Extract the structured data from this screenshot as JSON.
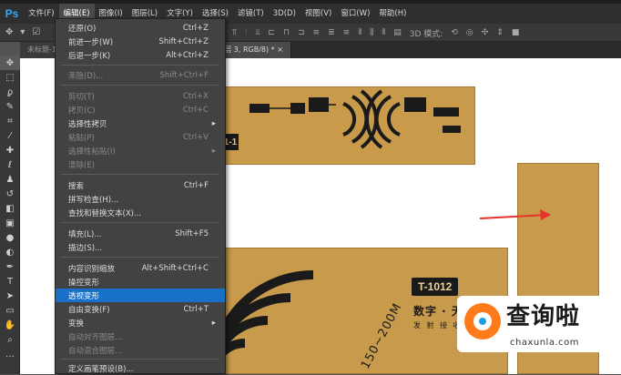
{
  "app": {
    "logo": "Ps"
  },
  "menubar": {
    "items": [
      "文件(F)",
      "编辑(E)",
      "图像(I)",
      "图层(L)",
      "文字(Y)",
      "选择(S)",
      "滤镜(T)",
      "3D(D)",
      "视图(V)",
      "窗口(W)",
      "帮助(H)"
    ],
    "active_index": 1
  },
  "optionsbar": {
    "mode_label": "3D 模式:"
  },
  "tabs": [
    {
      "label": "未标题-1",
      "close": "×"
    },
    {
      "label": "图层 3, RGB/8) *",
      "close": "×"
    }
  ],
  "edit_menu": {
    "items": [
      {
        "label": "还原(O)",
        "shortcut": "Ctrl+Z",
        "disabled": false
      },
      {
        "label": "前进一步(W)",
        "shortcut": "Shift+Ctrl+Z",
        "disabled": false
      },
      {
        "label": "后退一步(K)",
        "shortcut": "Alt+Ctrl+Z",
        "disabled": false
      },
      {
        "label": "渐隐(D)...",
        "shortcut": "Shift+Ctrl+F",
        "disabled": true
      },
      {
        "label": "剪切(T)",
        "shortcut": "Ctrl+X",
        "disabled": true
      },
      {
        "label": "拷贝(C)",
        "shortcut": "Ctrl+C",
        "disabled": true
      },
      {
        "label": "选择性拷贝",
        "shortcut": "",
        "disabled": false,
        "submenu": true
      },
      {
        "label": "粘贴(P)",
        "shortcut": "Ctrl+V",
        "disabled": true
      },
      {
        "label": "选择性粘贴(I)",
        "shortcut": "",
        "disabled": true,
        "submenu": true
      },
      {
        "label": "清除(E)",
        "shortcut": "",
        "disabled": true
      },
      {
        "label": "搜索",
        "shortcut": "Ctrl+F",
        "disabled": false
      },
      {
        "label": "拼写检查(H)...",
        "shortcut": "",
        "disabled": false
      },
      {
        "label": "查找和替换文本(X)...",
        "shortcut": "",
        "disabled": false
      },
      {
        "label": "填充(L)...",
        "shortcut": "Shift+F5",
        "disabled": false
      },
      {
        "label": "描边(S)...",
        "shortcut": "",
        "disabled": false
      },
      {
        "label": "内容识别缩放",
        "shortcut": "Alt+Shift+Ctrl+C",
        "disabled": false
      },
      {
        "label": "操控变形",
        "shortcut": "",
        "disabled": false
      },
      {
        "label": "透视变形",
        "shortcut": "",
        "disabled": false,
        "highlighted": true
      },
      {
        "label": "自由变换(F)",
        "shortcut": "Ctrl+T",
        "disabled": false
      },
      {
        "label": "变换",
        "shortcut": "",
        "disabled": false,
        "submenu": true
      },
      {
        "label": "自动对齐图层...",
        "shortcut": "",
        "disabled": true
      },
      {
        "label": "自动混合图层...",
        "shortcut": "",
        "disabled": true
      },
      {
        "label": "定义画笔预设(B)...",
        "shortcut": "",
        "disabled": false
      }
    ]
  },
  "canvas": {
    "card_label": "1-1",
    "model": "T-1012",
    "title": "数字 · 无线",
    "subtitle": "发 射 接 收 这",
    "range_text": "150~200M"
  },
  "watermark": {
    "text": "查询啦",
    "url": "chaxunla.com"
  },
  "colors": {
    "accent": "#1870c8",
    "card": "#c89a4b",
    "arrow": "#e8332a",
    "logo_orange": "#ff7a1a"
  }
}
